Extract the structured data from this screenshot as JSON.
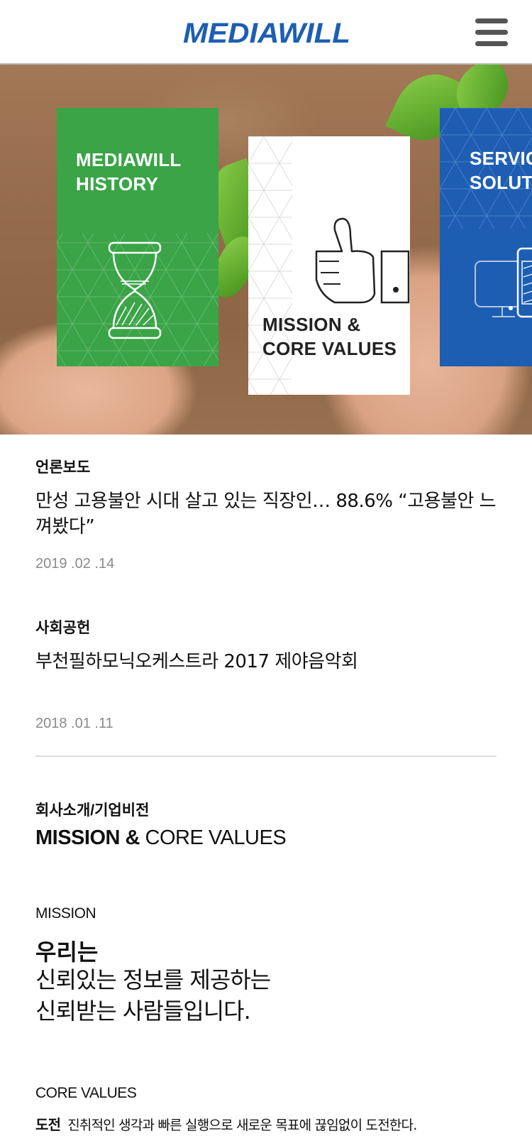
{
  "header": {
    "logo_text": "MEDIAWILL",
    "menu_icon": "hamburger-menu-icon",
    "brand_color": "#1d5eb3"
  },
  "hero": {
    "cards": [
      {
        "title": "MEDIAWILL\nHISTORY",
        "icon": "hourglass-icon",
        "color": "#3aa447"
      },
      {
        "title": "MISSION &\nCORE VALUES",
        "icon": "thumbs-up-icon",
        "color": "#ffffff"
      },
      {
        "title": "SERVIC\nSOLUT",
        "icon": "devices-icon",
        "color": "#1d5eb3"
      }
    ]
  },
  "news": [
    {
      "category": "언론보도",
      "title": "만성 고용불안 시대 살고 있는 직장인… 88.6% “고용불안 느껴봤다”",
      "date": "2019 .02 .14"
    },
    {
      "category": "사회공헌",
      "title": "부천필하모닉오케스트라 2017 제야음악회",
      "date": "2018 .01 .11"
    }
  ],
  "section": {
    "breadcrumb": "회사소개/기업비전",
    "title_bold": "MISSION &",
    "title_regular": " CORE VALUES"
  },
  "mission": {
    "label": "MISSION",
    "lead": "우리는",
    "line1": "신뢰있는 정보를 제공하는",
    "line2": "신뢰받는 사람들입니다."
  },
  "core_values": {
    "label": "CORE VALUES",
    "items": [
      {
        "name": "도전",
        "text": "진취적인 생각과 빠른 실행으로 새로운 목표에 끊임없이 도전한다."
      }
    ]
  }
}
